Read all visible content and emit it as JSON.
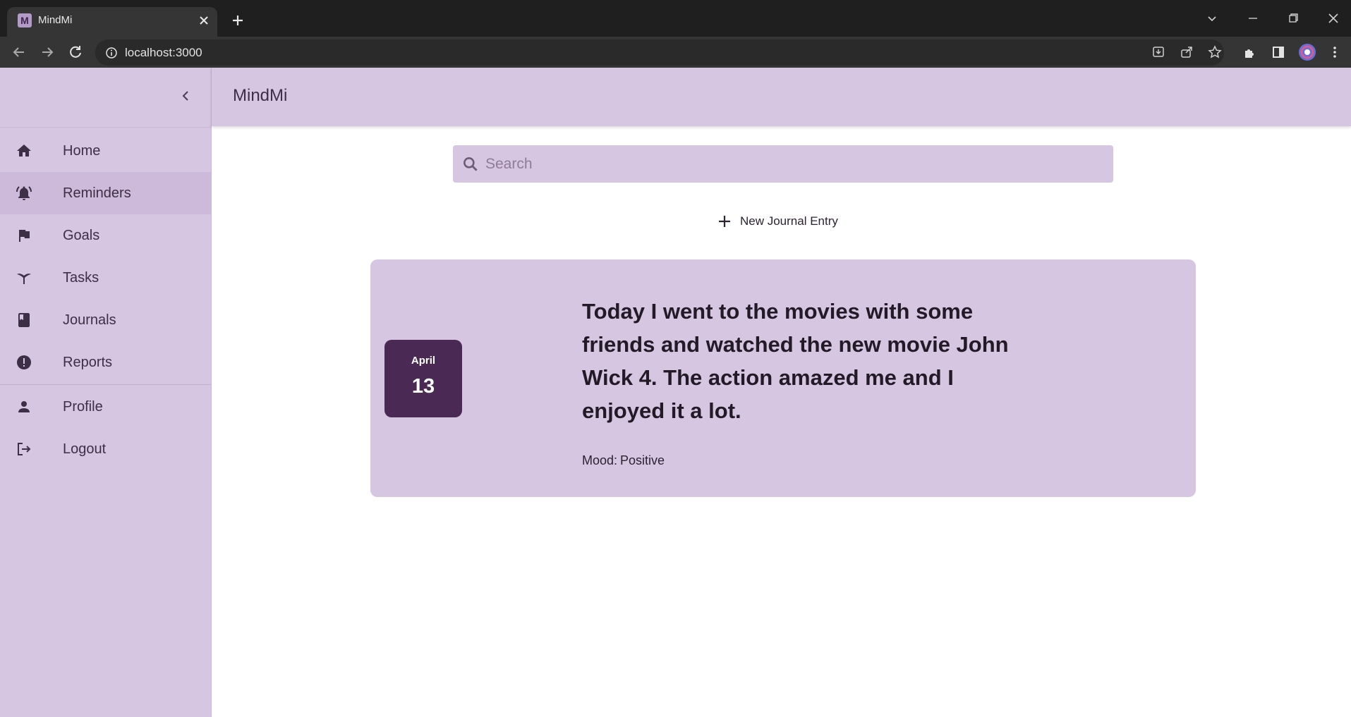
{
  "browser": {
    "tab_title": "MindMi",
    "favicon_letter": "M",
    "url": "localhost:3000"
  },
  "app": {
    "title": "MindMi",
    "accent_color": "#d7c6e1",
    "date_color": "#4a2a55"
  },
  "sidebar": {
    "items": [
      {
        "label": "Home",
        "icon": "home-icon"
      },
      {
        "label": "Reminders",
        "icon": "bell-ringing-icon",
        "active": true
      },
      {
        "label": "Goals",
        "icon": "flag-icon"
      },
      {
        "label": "Tasks",
        "icon": "tasks-icon"
      },
      {
        "label": "Journals",
        "icon": "book-icon"
      },
      {
        "label": "Reports",
        "icon": "exclamation-circle-icon"
      },
      {
        "label": "Profile",
        "icon": "person-icon"
      },
      {
        "label": "Logout",
        "icon": "logout-icon"
      }
    ]
  },
  "search": {
    "placeholder": "Search"
  },
  "journal": {
    "new_entry_label": "New Journal Entry",
    "entries": [
      {
        "month": "April",
        "day": "13",
        "text": "Today I went to the movies with some friends and watched the new movie John Wick 4. The action amazed me and I enjoyed it a lot.",
        "mood_label": "Mood:",
        "mood": "Positive"
      }
    ]
  }
}
